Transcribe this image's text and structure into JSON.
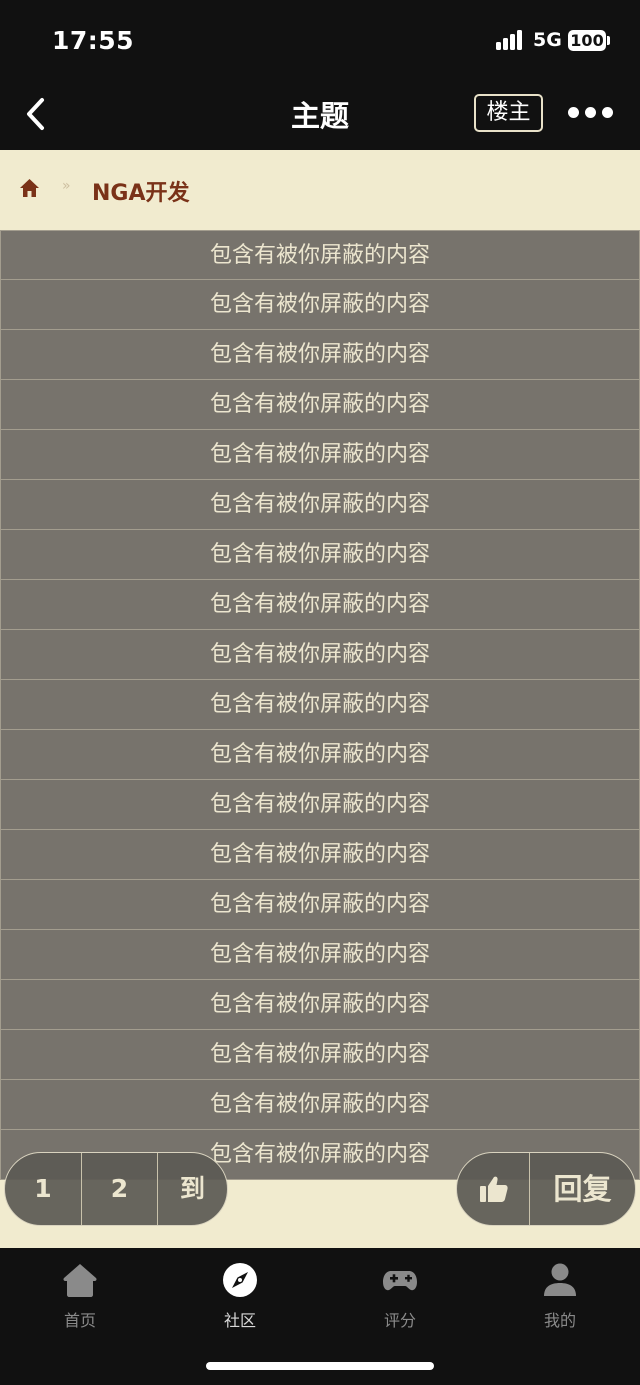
{
  "status_bar": {
    "time": "17:55",
    "network": "5G",
    "battery": "100"
  },
  "nav": {
    "title": "主题",
    "owner_filter": "楼主"
  },
  "breadcrumb": {
    "forum": "NGA开发"
  },
  "posts": {
    "blocked_text": "包含有被你屏蔽的内容",
    "rows": [
      "包含有被你屏蔽的内容",
      "包含有被你屏蔽的内容",
      "包含有被你屏蔽的内容",
      "包含有被你屏蔽的内容",
      "包含有被你屏蔽的内容",
      "包含有被你屏蔽的内容",
      "包含有被你屏蔽的内容",
      "包含有被你屏蔽的内容",
      "包含有被你屏蔽的内容",
      "包含有被你屏蔽的内容",
      "包含有被你屏蔽的内容",
      "包含有被你屏蔽的内容",
      "包含有被你屏蔽的内容",
      "包含有被你屏蔽的内容",
      "包含有被你屏蔽的内容",
      "包含有被你屏蔽的内容",
      "包含有被你屏蔽的内容",
      "包含有被你屏蔽的内容",
      "包含有被你屏蔽的内容"
    ]
  },
  "pager": {
    "page1": "1",
    "page2": "2",
    "goto": "到"
  },
  "actions": {
    "reply": "回复"
  },
  "tabs": [
    {
      "label": "首页",
      "icon": "home-icon"
    },
    {
      "label": "社区",
      "icon": "compass-icon",
      "active": true
    },
    {
      "label": "评分",
      "icon": "gamepad-icon"
    },
    {
      "label": "我的",
      "icon": "user-icon"
    }
  ],
  "colors": {
    "background": "#111111",
    "content_bg": "#f1ebcf",
    "row_bg": "#77736c",
    "forum_link": "#7a3218"
  }
}
